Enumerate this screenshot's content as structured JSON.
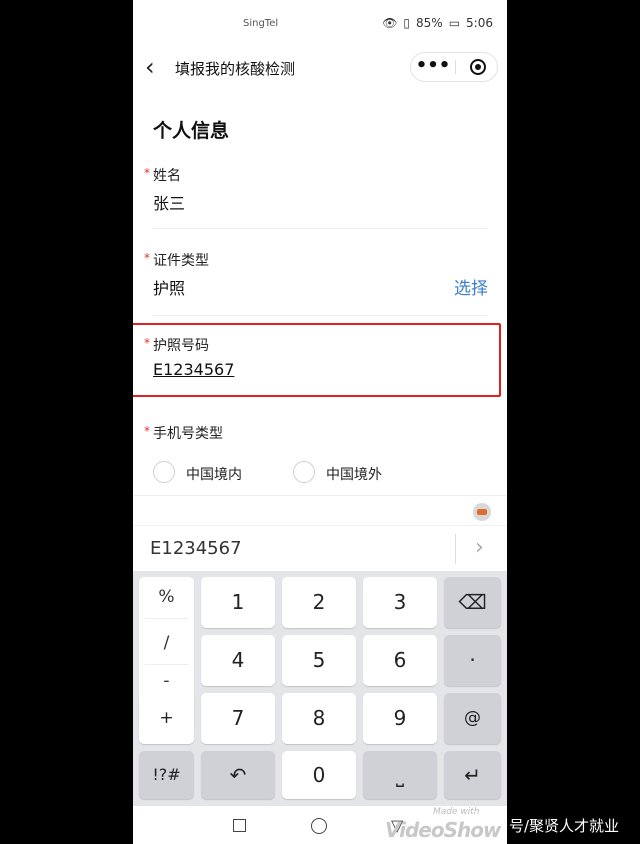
{
  "status_bar": {
    "carrier": "SingTel",
    "battery": "85%",
    "time": "5:06"
  },
  "nav": {
    "back": "‹",
    "title": "填报我的核酸检测",
    "more": "•••"
  },
  "form": {
    "section_title": "个人信息",
    "required_mark": "*",
    "name_label": "姓名",
    "name_value": "张三",
    "id_type_label": "证件类型",
    "id_type_value": "护照",
    "select_label": "选择",
    "passport_label": "护照号码",
    "passport_value": "E1234567",
    "phone_type_label": "手机号类型",
    "phone_options": [
      "中国境内",
      "中国境外"
    ]
  },
  "keyboard": {
    "input_text": "E1234567",
    "arrow": "›",
    "left_symbols": [
      "%",
      "/",
      "-",
      "+"
    ],
    "digits": [
      "1",
      "2",
      "3",
      "4",
      "5",
      "6",
      "7",
      "8",
      "9",
      "0"
    ],
    "dot": "·",
    "at": "@",
    "symbols": "!?#",
    "backspace": "⌫",
    "undo": "↶",
    "space": "⎵",
    "enter": "↵"
  },
  "watermark": {
    "made_with": "Made with",
    "brand": "VideoShow"
  },
  "caption": {
    "text": "号/聚贤人才就业"
  },
  "colors": {
    "accent_blue": "#3a7fcf",
    "required_red": "#e0322f",
    "highlight_red": "#e02020"
  }
}
